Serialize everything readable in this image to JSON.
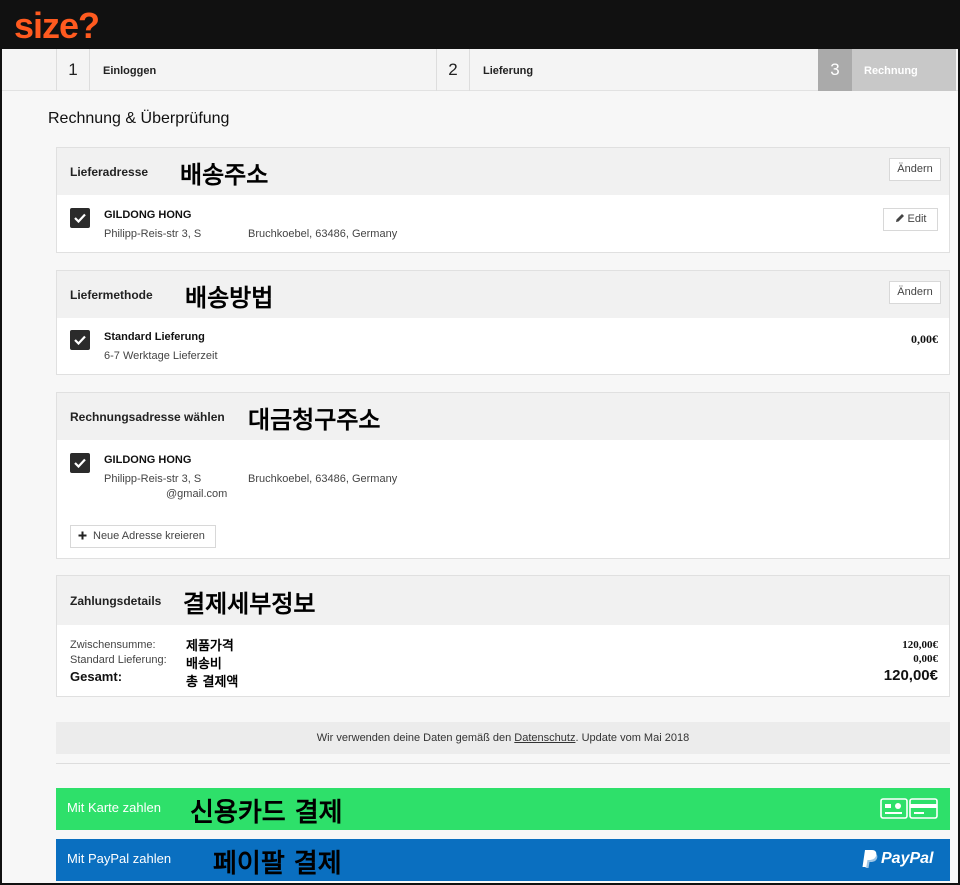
{
  "brand": {
    "logo_text": "size?",
    "accent": "#ff5a1f"
  },
  "steps": [
    {
      "num": "1",
      "label": "Einloggen"
    },
    {
      "num": "2",
      "label": "Lieferung"
    },
    {
      "num": "3",
      "label": "Rechnung"
    }
  ],
  "page_title": "Rechnung & Überprüfung",
  "delivery_address": {
    "title": "Lieferadresse",
    "annotation": "배송주소",
    "change_label": "Ändern",
    "name": "GILDONG HONG",
    "street": "Philipp-Reis-str 3, S",
    "city": "Bruchkoebel, 63486, Germany",
    "edit_label": "Edit"
  },
  "delivery_method": {
    "title": "Liefermethode",
    "annotation": "배송방법",
    "change_label": "Ändern",
    "name": "Standard Lieferung",
    "detail": "6-7 Werktage Lieferzeit",
    "price": "0,00€"
  },
  "billing_address": {
    "title": "Rechnungsadresse wählen",
    "annotation": "대금청구주소",
    "name": "GILDONG HONG",
    "street": "Philipp-Reis-str 3, S",
    "city": "Bruchkoebel, 63486, Germany",
    "email": "@gmail.com",
    "new_address_label": "Neue Adresse kreieren"
  },
  "payment_details": {
    "title": "Zahlungsdetails",
    "annotation": "결제세부정보",
    "rows": [
      {
        "label": "Zwischensumme:",
        "annotation": "제품가격",
        "value": "120,00€"
      },
      {
        "label": "Standard Lieferung:",
        "annotation": "배송비",
        "value": "0,00€"
      },
      {
        "label": "Gesamt:",
        "annotation": "총 결제액",
        "value": "120,00€"
      }
    ]
  },
  "privacy": {
    "before": "Wir verwenden deine Daten gemäß den ",
    "link": "Datenschutz",
    "after": ". Update vom Mai 2018"
  },
  "pay_card": {
    "label": "Mit Karte zahlen",
    "annotation": "신용카드 결제",
    "color": "#2ee06a"
  },
  "pay_paypal": {
    "label": "Mit PayPal zahlen",
    "annotation": "페이팔 결제",
    "brand": "PayPal",
    "color": "#0a6fc0"
  }
}
